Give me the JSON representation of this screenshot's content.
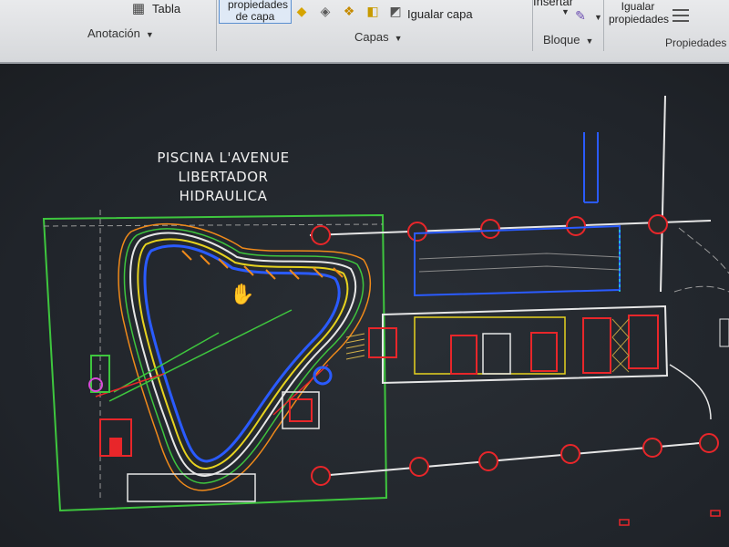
{
  "ribbon": {
    "anotacion": {
      "tabla_label": "Tabla",
      "panel_title": "Anotación"
    },
    "capas": {
      "propiedades_de_capa_label": "propiedades de capa",
      "igualar_capa_label": "Igualar capa",
      "panel_title": "Capas"
    },
    "bloque": {
      "insertar_label": "Insertar",
      "panel_title": "Bloque"
    },
    "propiedades": {
      "igualar_propiedades_label": "Igualar propiedades",
      "panel_title": "Propiedades"
    }
  },
  "drawing": {
    "title_line1": "PISCINA L'AVENUE",
    "title_line2": "LIBERTADOR",
    "title_line3": "HIDRAULICA"
  },
  "colors": {
    "canvas_bg": "#22262b",
    "ribbon_bg": "#e3e4e6",
    "layer_green": "#3ec63e",
    "layer_yellow": "#e7d31f",
    "layer_blue": "#2a5bff",
    "layer_red": "#e8262a",
    "layer_orange": "#f08a1a",
    "layer_cyan": "#21d6d6",
    "layer_white": "#e6e6e6"
  },
  "icons": [
    "table-icon",
    "layer-on-icon",
    "layer-off-icon",
    "layer-isolate-icon",
    "layer-freeze-icon",
    "match-layer-icon",
    "match-properties-icon",
    "pan-hand-cursor-icon"
  ]
}
